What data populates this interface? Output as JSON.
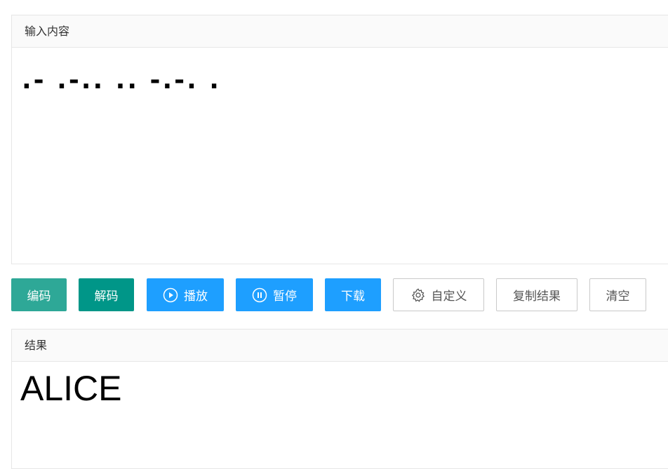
{
  "input_panel": {
    "title": "输入内容",
    "value": ".- .-.. .. -.-. ."
  },
  "toolbar": {
    "encode_label": "编码",
    "decode_label": "解码",
    "play_label": "播放",
    "pause_label": "暂停",
    "download_label": "下载",
    "customize_label": "自定义",
    "copy_label": "复制结果",
    "clear_label": "清空",
    "icons": {
      "play": "play-circle-icon",
      "pause": "pause-circle-icon",
      "customize": "gear-icon"
    },
    "colors": {
      "encode": "#2ea897",
      "decode": "#009688",
      "blue": "#1e9fff"
    }
  },
  "result_panel": {
    "title": "结果",
    "value": "ALICE"
  }
}
